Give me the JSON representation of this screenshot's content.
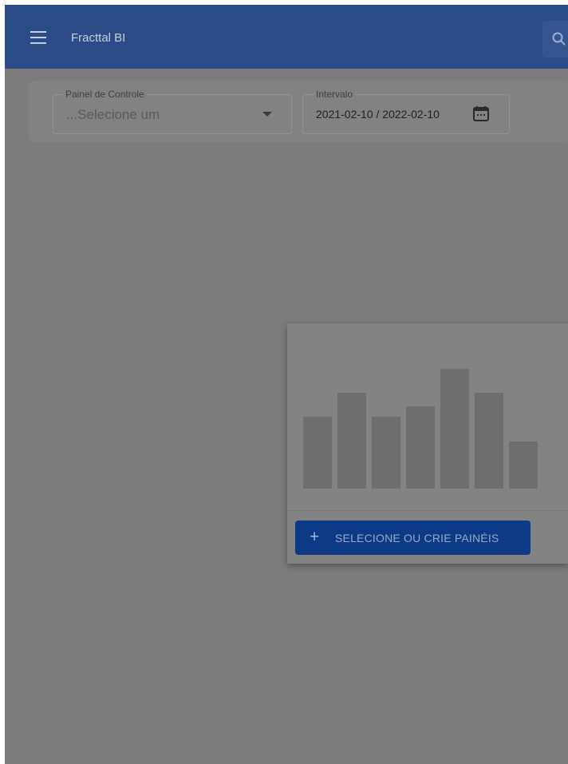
{
  "appbar": {
    "title": "Fracttal BI",
    "menu_icon": "hamburger-menu-icon",
    "search_icon": "search-icon",
    "color": "#2c4c88"
  },
  "filters": {
    "dashboard": {
      "label": "Painel de Controle",
      "placeholder": "...Selecione um",
      "icon": "dropdown-caret-icon"
    },
    "interval": {
      "label": "Intervalo",
      "value": "2021-02-10 / 2022-02-10",
      "icon": "calendar-icon"
    }
  },
  "empty_state": {
    "illustration": "bar-chart-illustration",
    "bar_levels": [
      0.59,
      0.79,
      0.59,
      0.68,
      0.99,
      0.79,
      0.39
    ],
    "button_label": "SELECIONE OU CRIE PAINÉIS",
    "button_icon": "plus-icon",
    "button_color": "#0d3a87"
  },
  "overlay": {
    "color": "#7c7c7c"
  }
}
